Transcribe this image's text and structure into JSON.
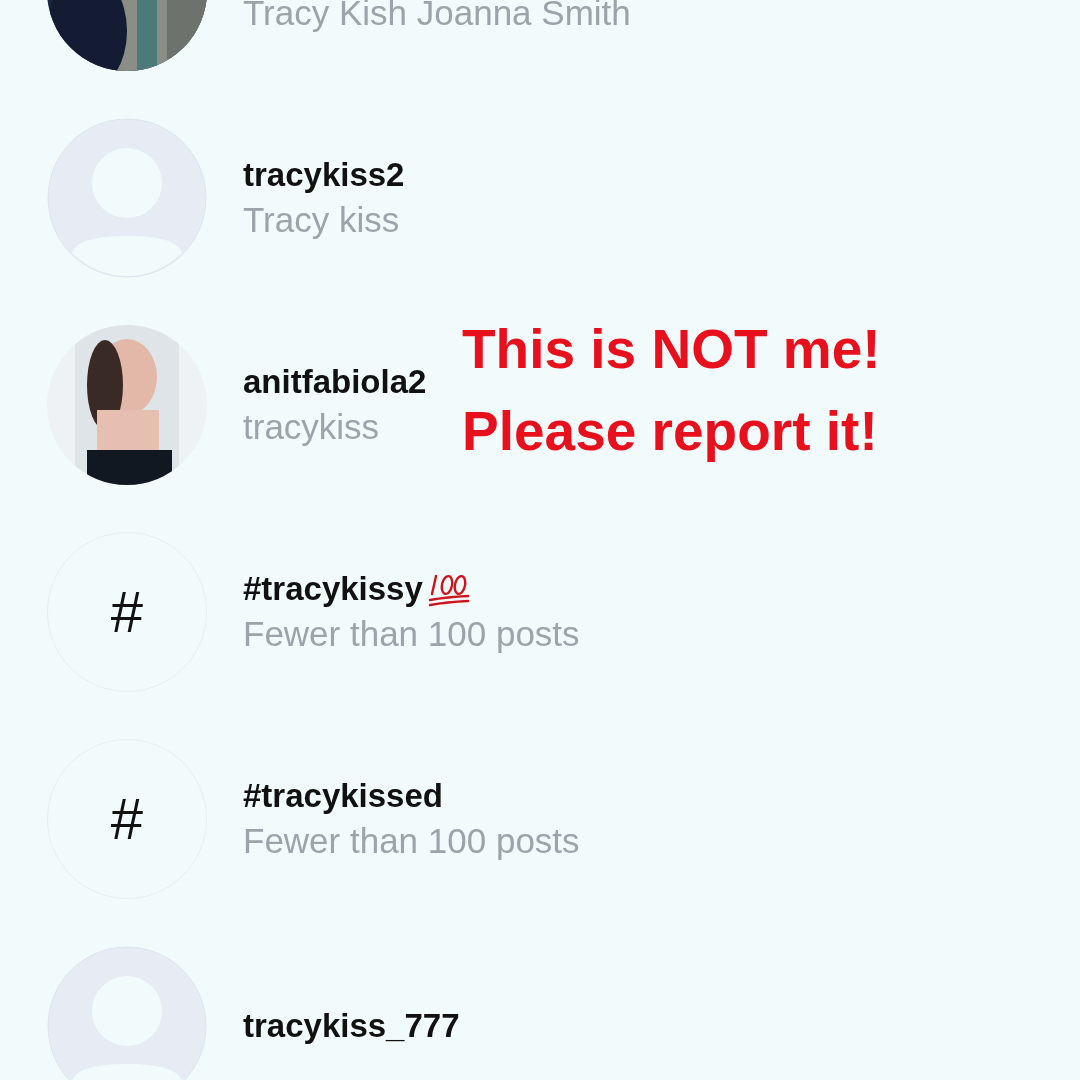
{
  "results": [
    {
      "subtitle": "Tracy Kish Joanna Smith"
    },
    {
      "avatar": {
        "kind": "placeholder"
      },
      "title": "tracykiss2",
      "subtitle": "Tracy kiss"
    },
    {
      "title": "anitfabiola2",
      "subtitle": "tracykiss",
      "overlay": [
        "This is NOT me!",
        "Please report it!"
      ]
    },
    {
      "avatar": {
        "kind": "hashtag",
        "symbol": "#"
      },
      "title": "#tracykissy",
      "hundred_badge": true,
      "subtitle": "Fewer than 100 posts"
    },
    {
      "avatar": {
        "kind": "hashtag",
        "symbol": "#"
      },
      "title": "#tracykissed",
      "subtitle": "Fewer than 100 posts"
    },
    {
      "avatar": {
        "kind": "placeholder"
      },
      "title": "tracykiss_777"
    }
  ]
}
